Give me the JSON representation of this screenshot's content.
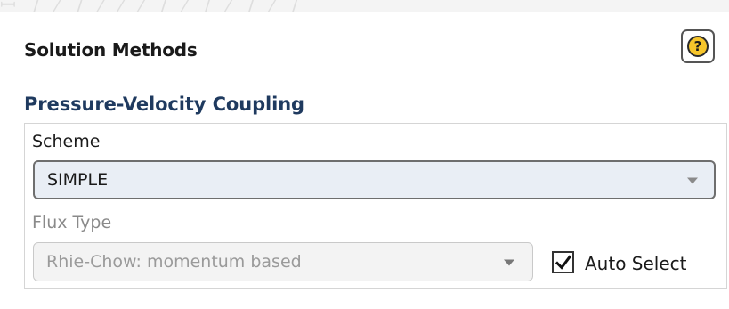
{
  "panel": {
    "title": "Solution Methods",
    "help_label": "?"
  },
  "pressure_velocity": {
    "heading": "Pressure-Velocity Coupling",
    "scheme": {
      "label": "Scheme",
      "selected": "SIMPLE"
    },
    "flux_type": {
      "label": "Flux Type",
      "selected": "Rhie-Chow: momentum based",
      "enabled": false
    },
    "auto_select": {
      "label": "Auto Select",
      "checked": true
    }
  },
  "icons": {
    "help": "help-icon",
    "dropdown": "chevron-down-icon",
    "check": "check-icon"
  },
  "colors": {
    "heading": "#1f3a5f",
    "help_fill": "#f6c52b",
    "select_bg": "#e9eef5"
  }
}
